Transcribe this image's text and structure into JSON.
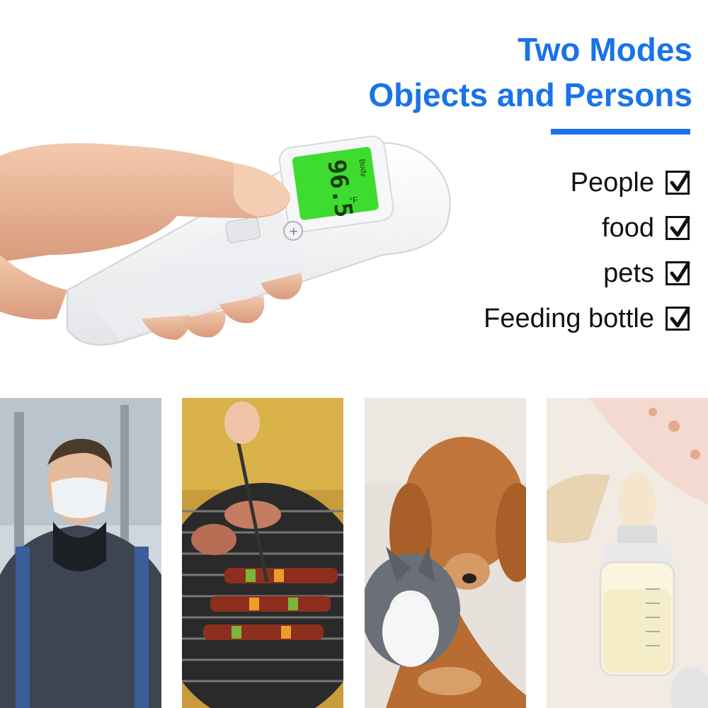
{
  "headline": {
    "line1": "Two Modes",
    "line2": "Objects and Persons",
    "color": "#1a73e8"
  },
  "uses": [
    {
      "label": "People",
      "checked": true
    },
    {
      "label": "food",
      "checked": true
    },
    {
      "label": "pets",
      "checked": true
    },
    {
      "label": "Feeding bottle",
      "checked": true
    }
  ],
  "display": {
    "mode": "Body",
    "reading": "96.5",
    "unit": "°F",
    "backlight_color": "#3ddc2e"
  },
  "icons": {
    "check": "check-icon",
    "plus": "plus-icon"
  }
}
